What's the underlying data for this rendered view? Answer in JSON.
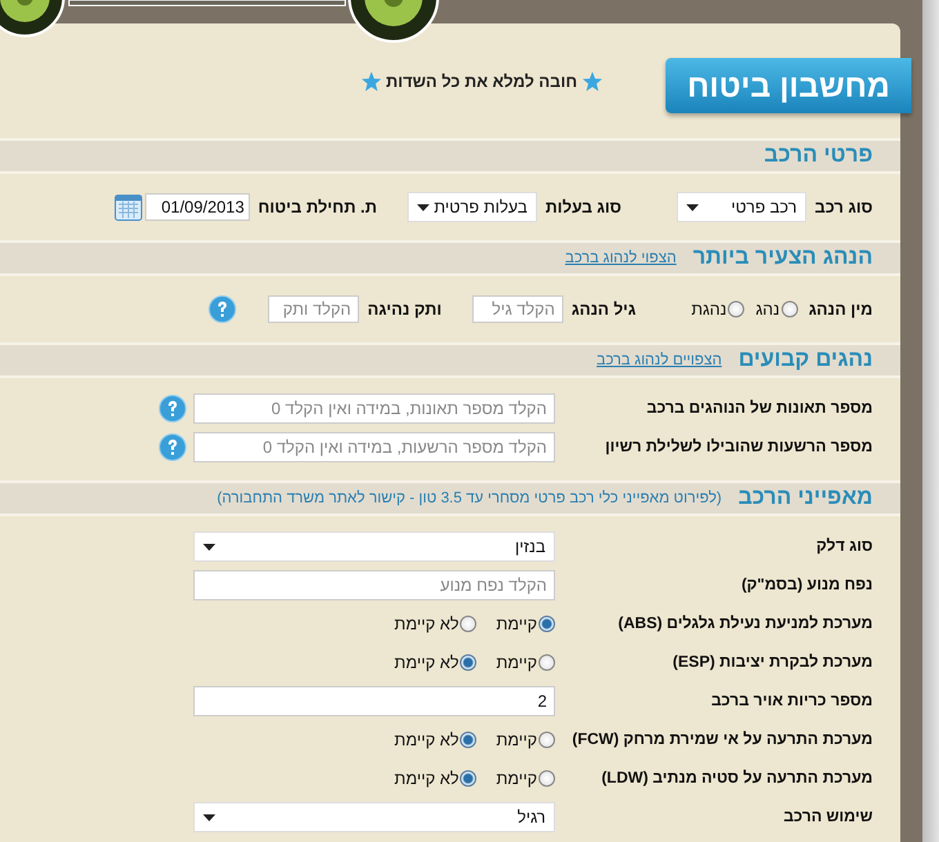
{
  "title": "מחשבון ביטוח",
  "notice": "חובה למלא את כל השדות",
  "sections": [
    {
      "title": "פרטי הרכב",
      "kind": "inline",
      "items": [
        {
          "kind": "select",
          "label": "סוג רכב",
          "value": "רכב פרטי"
        },
        {
          "kind": "select",
          "label": "סוג בעלות",
          "value": "בעלות פרטית"
        },
        {
          "kind": "date",
          "label": "ת. תחילת ביטוח",
          "value": "01/09/2013"
        }
      ]
    },
    {
      "title": "הנהג הצעיר ביותר",
      "link": "הצפוי לנהוג ברכב",
      "kind": "inline",
      "items": [
        {
          "kind": "radio",
          "label": "מין הנהג",
          "options": [
            {
              "label": "נהג",
              "selected": false
            },
            {
              "label": "נהגת",
              "selected": false
            }
          ]
        },
        {
          "kind": "text",
          "label": "גיל הנהג",
          "placeholder": "הקלד גיל"
        },
        {
          "kind": "text",
          "label": "ותק נהיגה",
          "placeholder": "הקלד ותק",
          "help": true
        }
      ]
    },
    {
      "title": "נהגים קבועים",
      "link": "הצפויים לנהוג ברכב",
      "kind": "rows",
      "items": [
        {
          "kind": "text",
          "label": "מספר תאונות של הנוהגים ברכב",
          "placeholder": "הקלד מספר תאונות, במידה ואין הקלד 0",
          "help": true
        },
        {
          "kind": "text",
          "label": "מספר הרשעות שהובילו לשלילת רשיון",
          "placeholder": "הקלד מספר הרשעות, במידה ואין הקלד 0",
          "help": true
        }
      ]
    },
    {
      "title": "מאפייני הרכב",
      "note": "(לפירוט מאפייני כלי רכב פרטי מסחרי עד 3.5 טון - קישור לאתר משרד התחבורה)",
      "kind": "rows",
      "items": [
        {
          "kind": "select",
          "label": "סוג דלק",
          "value": "בנזין"
        },
        {
          "kind": "text",
          "label": "נפח מנוע (בסמ\"ק)",
          "placeholder": "הקלד נפח מנוע"
        },
        {
          "kind": "radio",
          "label": "מערכת למניעת נעילת גלגלים (ABS)",
          "options": [
            {
              "label": "קיימת",
              "selected": true
            },
            {
              "label": "לא קיימת",
              "selected": false
            }
          ]
        },
        {
          "kind": "radio",
          "label": "מערכת לבקרת יציבות (ESP)",
          "options": [
            {
              "label": "קיימת",
              "selected": false
            },
            {
              "label": "לא קיימת",
              "selected": true
            }
          ]
        },
        {
          "kind": "text",
          "label": "מספר כריות אויר ברכב",
          "value": "2"
        },
        {
          "kind": "radio",
          "label": "מערכת התרעה על אי שמירת מרחק (FCW)",
          "options": [
            {
              "label": "קיימת",
              "selected": false
            },
            {
              "label": "לא קיימת",
              "selected": true
            }
          ]
        },
        {
          "kind": "radio",
          "label": "מערכת התרעה על סטיה מנתיב (LDW)",
          "options": [
            {
              "label": "קיימת",
              "selected": false
            },
            {
              "label": "לא קיימת",
              "selected": true
            }
          ]
        },
        {
          "kind": "select",
          "label": "שימוש הרכב",
          "value": "רגיל"
        }
      ]
    }
  ]
}
